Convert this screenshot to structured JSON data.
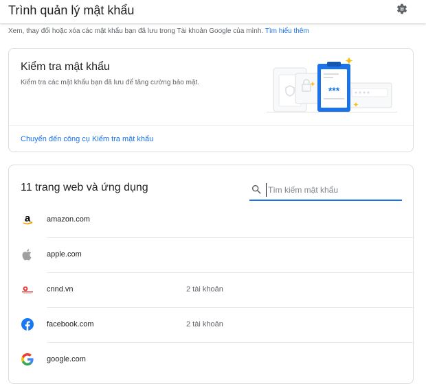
{
  "header": {
    "title": "Trình quản lý mật khẩu",
    "settings_icon": "gear-icon"
  },
  "subtitle": {
    "text": "Xem, thay đổi hoặc xóa các mật khẩu bạn đã lưu trong Tài khoản Google của mình.",
    "link": "Tìm hiểu thêm"
  },
  "checkup": {
    "title": "Kiểm tra mật khẩu",
    "description": "Kiểm tra các mật khẩu bạn đã lưu để tăng cường bảo mật.",
    "link": "Chuyển đến công cụ Kiểm tra mật khẩu",
    "illustration_text": "***"
  },
  "list": {
    "title": "11 trang web và ứng dụng",
    "search_placeholder": "Tìm kiếm mật khẩu",
    "items": [
      {
        "site": "amazon.com",
        "count": "",
        "icon": "amazon-icon"
      },
      {
        "site": "apple.com",
        "count": "",
        "icon": "apple-icon"
      },
      {
        "site": "cnnd.vn",
        "count": "2 tài khoản",
        "icon": "cnnd-icon"
      },
      {
        "site": "facebook.com",
        "count": "2 tài khoản",
        "icon": "facebook-icon"
      },
      {
        "site": "google.com",
        "count": "",
        "icon": "google-icon"
      }
    ]
  },
  "colors": {
    "accent": "#1a73e8",
    "text": "#202124",
    "secondary": "#5f6368",
    "border": "#dadce0"
  }
}
